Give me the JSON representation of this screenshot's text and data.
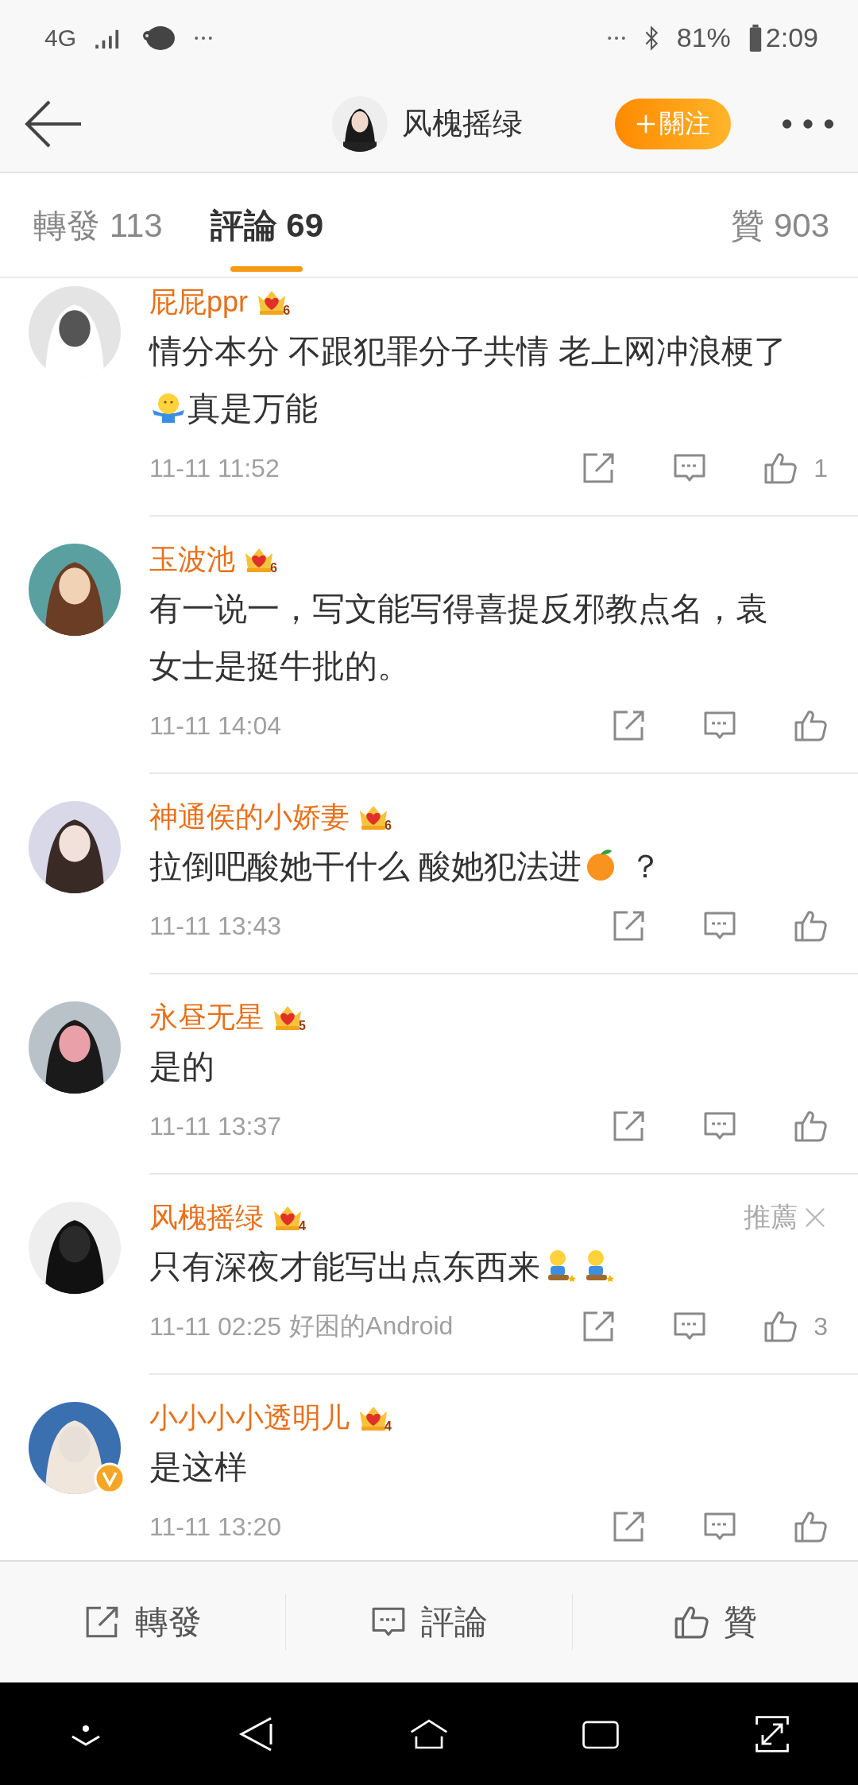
{
  "status_bar": {
    "network": "4G",
    "battery": "81%",
    "time": "2:09"
  },
  "header": {
    "title": "风槐摇绿",
    "follow_button": "關注"
  },
  "tabs": [
    {
      "label": "轉發",
      "count": "113",
      "selected": false
    },
    {
      "label": "評論",
      "count": "69",
      "selected": true
    },
    {
      "label": "贊",
      "count": "903",
      "selected": false
    }
  ],
  "comments": [
    {
      "name": "屁屁ppr",
      "crown": "6",
      "verified": false,
      "body": [
        {
          "kind": "text",
          "text": "情分本分 不跟犯罪分子共情 老上网冲浪梗了"
        },
        {
          "kind": "shrug"
        },
        {
          "kind": "text",
          "text": "真是万能"
        }
      ],
      "time": "11-11 11:52",
      "likes": "1"
    },
    {
      "name": "玉波池",
      "crown": "6",
      "verified": false,
      "body": [
        {
          "kind": "text",
          "text": "有一说一，写文能写得喜提反邪教点名，袁女士是挺牛批的。"
        }
      ],
      "time": "11-11 14:04"
    },
    {
      "name": "神通侯的小娇妻",
      "crown": "6",
      "verified": false,
      "body": [
        {
          "kind": "text",
          "text": "拉倒吧酸她干什么 酸她犯法进"
        },
        {
          "kind": "citrus"
        },
        {
          "kind": "text",
          "text": " ？"
        }
      ],
      "time": "11-11 13:43"
    },
    {
      "name": "永昼无星",
      "crown": "5",
      "verified": false,
      "body": [
        {
          "kind": "text",
          "text": "是的"
        }
      ],
      "time": "11-11 13:37"
    },
    {
      "name": "风槐摇绿",
      "crown": "4",
      "verified": false,
      "recommended": "推薦",
      "body": [
        {
          "kind": "text",
          "text": "只有深夜才能写出点东西来"
        },
        {
          "kind": "kneel"
        },
        {
          "kind": "kneel"
        }
      ],
      "time": "11-11 02:25",
      "source": "好困的Android",
      "likes": "3"
    },
    {
      "name": "小小小小透明儿",
      "crown": "4",
      "verified": true,
      "body": [
        {
          "kind": "text",
          "text": "是这样"
        }
      ],
      "time": "11-11 13:20"
    }
  ],
  "action_bar": [
    {
      "kind": "share",
      "label": "轉發"
    },
    {
      "kind": "comment",
      "label": "評論"
    },
    {
      "kind": "like",
      "label": "贊"
    }
  ]
}
